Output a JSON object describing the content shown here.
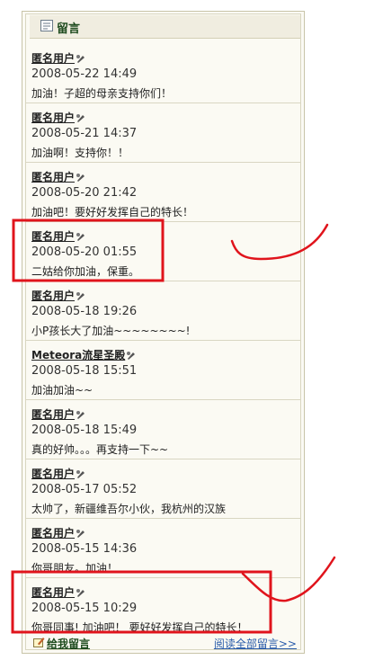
{
  "panel": {
    "title": "留言"
  },
  "comments": [
    {
      "author": "匿名用户",
      "date": "2008-05-22 14:49",
      "message": "加油！子超的母亲支持你们！"
    },
    {
      "author": "匿名用户",
      "date": "2008-05-21 14:37",
      "message": "加油啊！支持你！！"
    },
    {
      "author": "匿名用户",
      "date": "2008-05-20 21:42",
      "message": "加油吧！要好好发挥自己的特长！"
    },
    {
      "author": "匿名用户",
      "date": "2008-05-20 01:55",
      "message": "二姑给你加油，保重。"
    },
    {
      "author": "匿名用户",
      "date": "2008-05-18 19:26",
      "message": "小P孩长大了加油~~~~~~~~!"
    },
    {
      "author": "Meteora流星圣殿",
      "date": "2008-05-18 15:51",
      "message": "加油加油~~"
    },
    {
      "author": "匿名用户",
      "date": "2008-05-18 15:49",
      "message": "真的好帅。。。再支持一下~~"
    },
    {
      "author": "匿名用户",
      "date": "2008-05-17 05:52",
      "message": "太帅了，新疆维吾尔小伙，我杭州的汉族"
    },
    {
      "author": "匿名用户",
      "date": "2008-05-15 14:36",
      "message": "你哥朋友。加油！"
    },
    {
      "author": "匿名用户",
      "date": "2008-05-15 10:29",
      "message": "你哥同事! 加油吧！  要好好发挥自己的特长！"
    }
  ],
  "footer": {
    "reply_label": "给我留言",
    "read_all_label": "阅读全部留言>>"
  },
  "annotations": {
    "color": "#e0141c"
  }
}
